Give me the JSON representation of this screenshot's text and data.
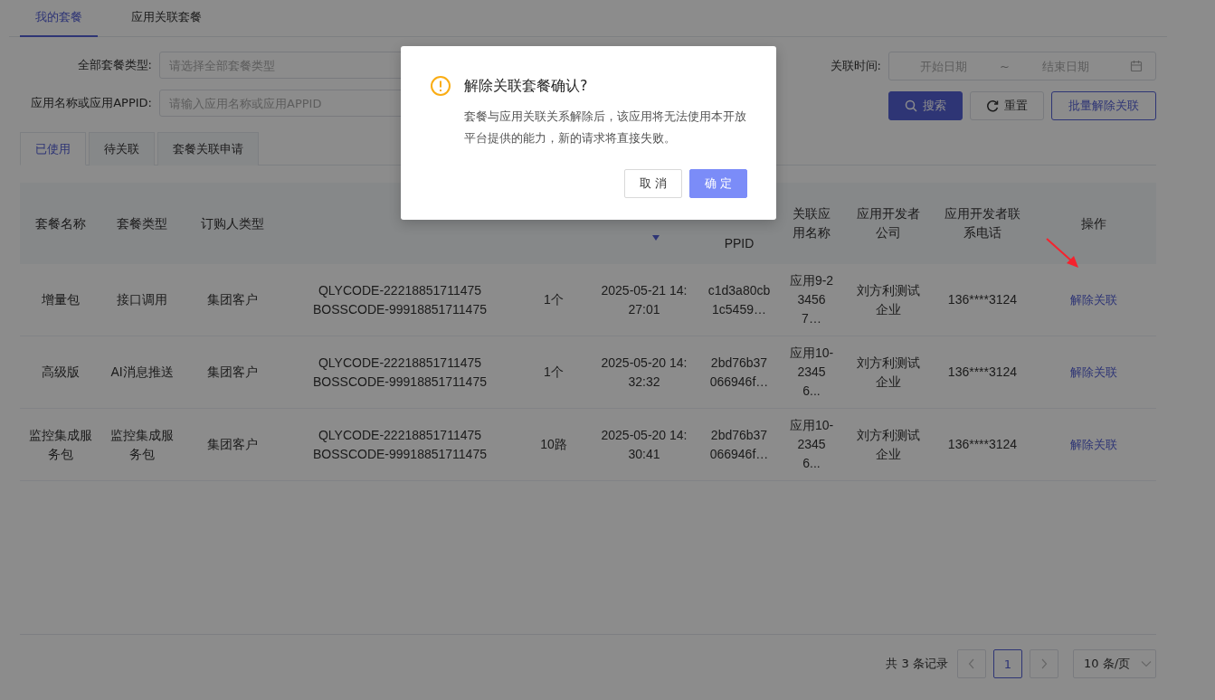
{
  "top_tabs": [
    {
      "label": "我的套餐",
      "selected": true
    },
    {
      "label": "应用关联套餐",
      "selected": false
    }
  ],
  "filters": {
    "package_type": {
      "label": "全部套餐类型:",
      "placeholder": "请选择全部套餐类型"
    },
    "app": {
      "label": "应用名称或应用APPID:",
      "placeholder": "请输入应用名称或应用APPID"
    },
    "time": {
      "label": "关联时间:",
      "start_placeholder": "开始日期",
      "separator": "~",
      "end_placeholder": "结束日期"
    }
  },
  "buttons": [
    {
      "kind": "search",
      "label": "搜索"
    },
    {
      "kind": "reset",
      "label": "重置"
    },
    {
      "kind": "outline",
      "label": "批量解除关联"
    }
  ],
  "sub_tabs": [
    {
      "label": "已使用",
      "selected": true
    },
    {
      "label": "待关联",
      "selected": false
    },
    {
      "label": "套餐关联申请",
      "selected": false
    }
  ],
  "table": {
    "columns": [
      {
        "label": "套餐名称"
      },
      {
        "label": "套餐类型"
      },
      {
        "label": "订购人类型"
      },
      {},
      {},
      {
        "sorted": true
      },
      {
        "label": "PPID"
      },
      {
        "label": "关联应用名称"
      },
      {
        "label": "应用开发者公司"
      },
      {
        "label": "应用开发者联系电话"
      },
      {
        "label": "操作"
      }
    ],
    "rows": [
      {
        "cells": [
          "增量包",
          "接口调用",
          "集团客户",
          "QLYCODE-22218851711475 BOSSCODE-99918851711475",
          "1个",
          "2025-05-21 14:27:01",
          "c1d3a80cb1c5459…",
          "应用9-234567…",
          "刘方利测试企业",
          "136****3124"
        ],
        "action": "解除关联"
      },
      {
        "cells": [
          "高级版",
          "AI消息推送",
          "集团客户",
          "QLYCODE-22218851711475 BOSSCODE-99918851711475",
          "1个",
          "2025-05-20 14:32:32",
          "2bd76b37066946f…",
          "应用10-23456...",
          "刘方利测试企业",
          "136****3124"
        ],
        "action": "解除关联"
      },
      {
        "cells": [
          "监控集成服务包",
          "监控集成服务包",
          "集团客户",
          "QLYCODE-22218851711475 BOSSCODE-99918851711475",
          "10路",
          "2025-05-20 14:30:41",
          "2bd76b37066946f…",
          "应用10-23456...",
          "刘方利测试企业",
          "136****3124"
        ],
        "action": "解除关联"
      }
    ]
  },
  "pagination": {
    "total": "共 3 条记录",
    "pages": [
      {
        "label": "1",
        "selected": true
      }
    ],
    "page_size": "10 条/页"
  },
  "dialog": {
    "title": "解除关联套餐确认?",
    "message": "套餐与应用关联关系解除后，该应用将无法使用本开放平台提供的能力，新的请求将直接失败。",
    "buttons": [
      {
        "kind": "cancel",
        "label": "取 消"
      },
      {
        "kind": "confirm",
        "label": "确 定"
      }
    ]
  }
}
